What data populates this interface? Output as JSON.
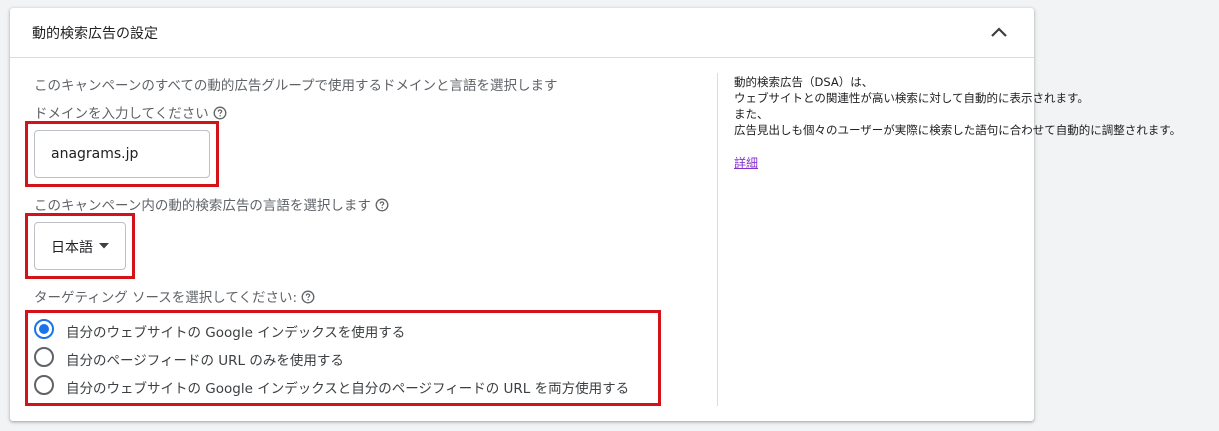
{
  "card": {
    "title": "動的検索広告の設定"
  },
  "domain_section": {
    "description": "このキャンペーンのすべての動的広告グループで使用するドメインと言語を選択します",
    "label": "ドメインを入力してください",
    "value": "anagrams.jp"
  },
  "language_section": {
    "label": "このキャンペーン内の動的検索広告の言語を選択します",
    "selected": "日本語"
  },
  "targeting_section": {
    "label": "ターゲティング ソースを選択してください:",
    "options": [
      {
        "label": "自分のウェブサイトの Google インデックスを使用する",
        "checked": true
      },
      {
        "label": "自分のページフィードの URL のみを使用する",
        "checked": false
      },
      {
        "label": "自分のウェブサイトの Google インデックスと自分のページフィードの URL を両方使用する",
        "checked": false
      }
    ]
  },
  "side_panel": {
    "lines": [
      "動的検索広告（DSA）は、",
      "ウェブサイトとの関連性が高い検索に対して自動的に表示されます。",
      "また、",
      "広告見出しも個々のユーザーが実際に検索した語句に合わせて自動的に調整されます。"
    ],
    "link": "詳細"
  },
  "colors": {
    "highlight_border": "#d3131a",
    "radio_checked": "#1a73e8",
    "link": "#8430ce"
  },
  "icons": {
    "collapse": "chevron-up-icon",
    "help": "help-circle-icon",
    "dropdown": "caret-down-icon"
  }
}
